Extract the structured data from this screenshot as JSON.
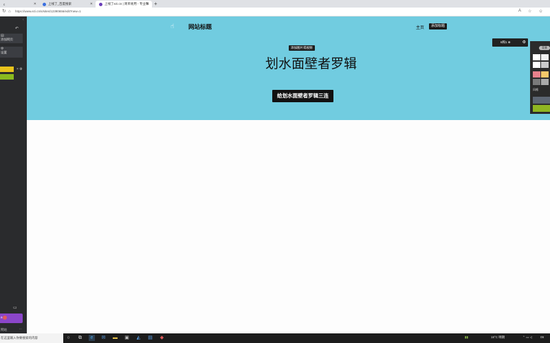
{
  "browser": {
    "tabs": [
      {
        "label": "c",
        "active": false
      },
      {
        "label": "上线了_百度搜索",
        "active": false
      },
      {
        "label": "上线了ezi.cn | 简单易用 - 专业和",
        "active": true
      }
    ],
    "new_tab": "+",
    "url": "https://www.ezi.cn/s/sites/12390656/edit?new=1",
    "nav_icons": {
      "back": "back-icon",
      "reload": "reload-icon"
    }
  },
  "sidebar": {
    "undo_icon": "undo-icon",
    "items": [
      {
        "label": "添加网页",
        "icon": "add-page-icon"
      },
      {
        "label": "设置",
        "icon": "gear-icon"
      }
    ],
    "colors": [
      "#e8c31c",
      "#8aba1f"
    ],
    "bottom_label": "a",
    "footer_label": "网站",
    "footer_more": "..."
  },
  "page": {
    "site_title": "网站标题",
    "nav": {
      "home": "主页",
      "add_title": "添加标题"
    },
    "add_image_label": "添加图片或视频",
    "hero_title": "划水面壁者罗辑",
    "hero_button": "给划水面壁者罗辑三连",
    "edit_chip_label": "6和1 ⊕"
  },
  "palette": {
    "pill_label": "背景",
    "label": "风格",
    "colors": {
      "row1": [
        "#ffffff",
        "#f2f2f2"
      ],
      "row2": [
        "#ffffff",
        "#cccccc"
      ],
      "row3": [
        "#e8818c",
        "#f5c86a"
      ],
      "row4": [
        "#7a7a7a",
        "#aaaaaa"
      ],
      "bar1": "#5d6673",
      "bar2": "#8fb521"
    }
  },
  "taskbar": {
    "search_placeholder": "在这里输入你要搜索的内容",
    "weather": "18°C 晴朗",
    "time": "09"
  }
}
